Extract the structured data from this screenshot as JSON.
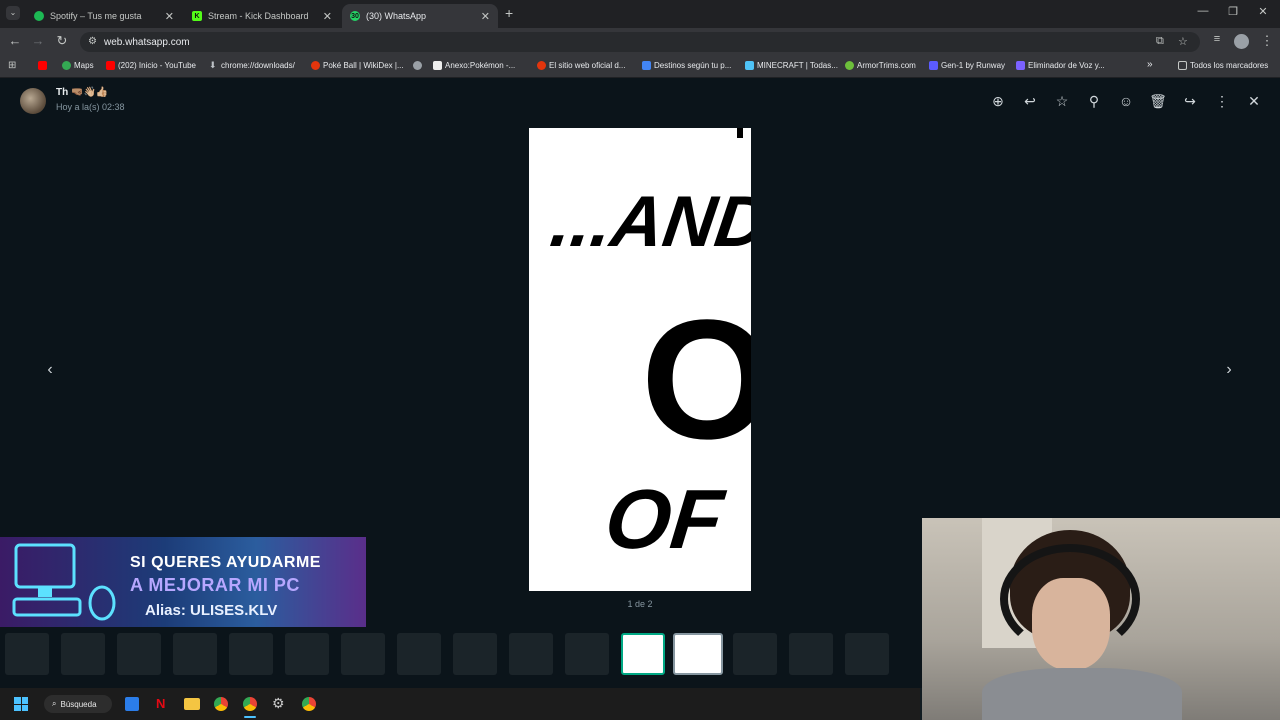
{
  "browser": {
    "tabs": [
      {
        "title": "Spotify – Tus me gusta",
        "icon": "spotify-icon",
        "color": "#1db954"
      },
      {
        "title": "Stream - Kick Dashboard",
        "icon": "kick-icon",
        "color": "#53fc18"
      },
      {
        "title": "(30) WhatsApp",
        "icon": "whatsapp-icon",
        "color": "#25d366",
        "badge": "30"
      }
    ],
    "url": "web.whatsapp.com",
    "bookmarks": [
      {
        "label": "Maps",
        "color": "#34a853"
      },
      {
        "label": "(202) Inicio - YouTube",
        "color": "#ff0000"
      },
      {
        "label": "chrome://downloads/",
        "color": "#bdc1c6"
      },
      {
        "label": "Poké Ball | WikiDex |...",
        "color": "#e3350d"
      },
      {
        "label": "",
        "color": "#9aa0a6"
      },
      {
        "label": "Anexo:Pokémon -...",
        "color": "#eeeeee"
      },
      {
        "label": "El sitio web oficial d...",
        "color": "#e3350d"
      },
      {
        "label": "Destinos según tu p...",
        "color": "#4285f4"
      },
      {
        "label": "MINECRAFT | Todas...",
        "color": "#4fc3f7"
      },
      {
        "label": "ArmorTrims.com",
        "color": "#6dbf3b"
      },
      {
        "label": "Gen-1 by Runway",
        "color": "#5b5bff"
      },
      {
        "label": "Eliminador de Voz y...",
        "color": "#7b61ff"
      }
    ],
    "all_bookmarks": "Todos los marcadores"
  },
  "viewer": {
    "sender": "Th 🤜🏽👋🏼👍🏼",
    "timestamp": "Hoy a la(s) 02:38",
    "counter": "1 de 2",
    "image_text": {
      "line1": "...AND YO",
      "line2": "ON",
      "line3": "OF T"
    },
    "icons": [
      "zoom-in-icon",
      "reply-icon",
      "star-icon",
      "pin-icon",
      "emoji-icon",
      "delete-icon",
      "forward-icon",
      "more-icon",
      "close-icon"
    ]
  },
  "banner": {
    "line1": "SI QUERES AYUDARME",
    "line2": "A MEJORAR MI PC",
    "line3": "Alias: ULISES.KLV"
  },
  "taskbar": {
    "search_label": "Búsqueda"
  }
}
